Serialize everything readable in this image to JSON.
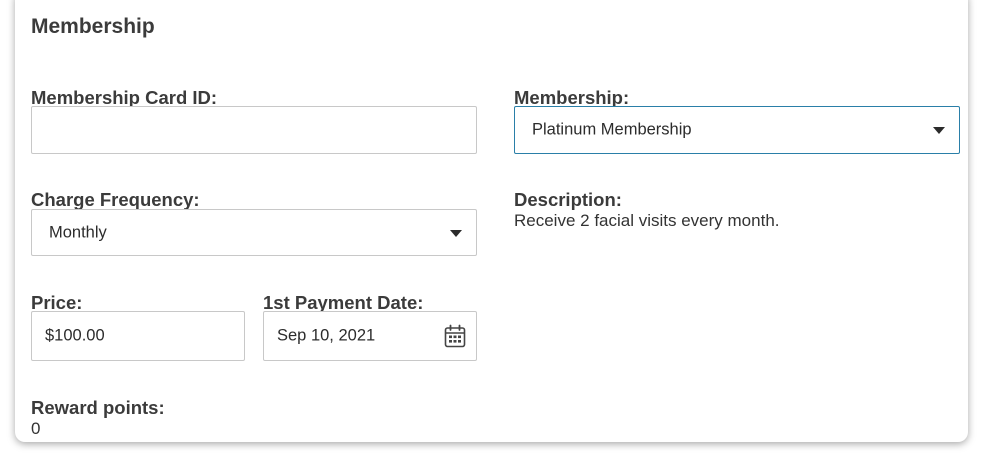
{
  "section": {
    "title": "Membership"
  },
  "membership_card": {
    "label": "Membership Card ID:",
    "value": ""
  },
  "membership": {
    "label": "Membership:",
    "selected": "Platinum Membership"
  },
  "charge_frequency": {
    "label": "Charge Frequency:",
    "selected": "Monthly"
  },
  "description": {
    "label": "Description:",
    "text": "Receive 2 facial visits every month."
  },
  "price": {
    "label": "Price:",
    "value": "$100.00"
  },
  "payment_date": {
    "label": "1st Payment Date:",
    "value": "Sep 10, 2021",
    "icon": "calendar-icon"
  },
  "reward_points": {
    "label": "Reward points:",
    "value": "0"
  },
  "colors": {
    "focus_border": "#2a7fa8",
    "border": "#c8c8c8",
    "text": "#3b3b3b"
  }
}
